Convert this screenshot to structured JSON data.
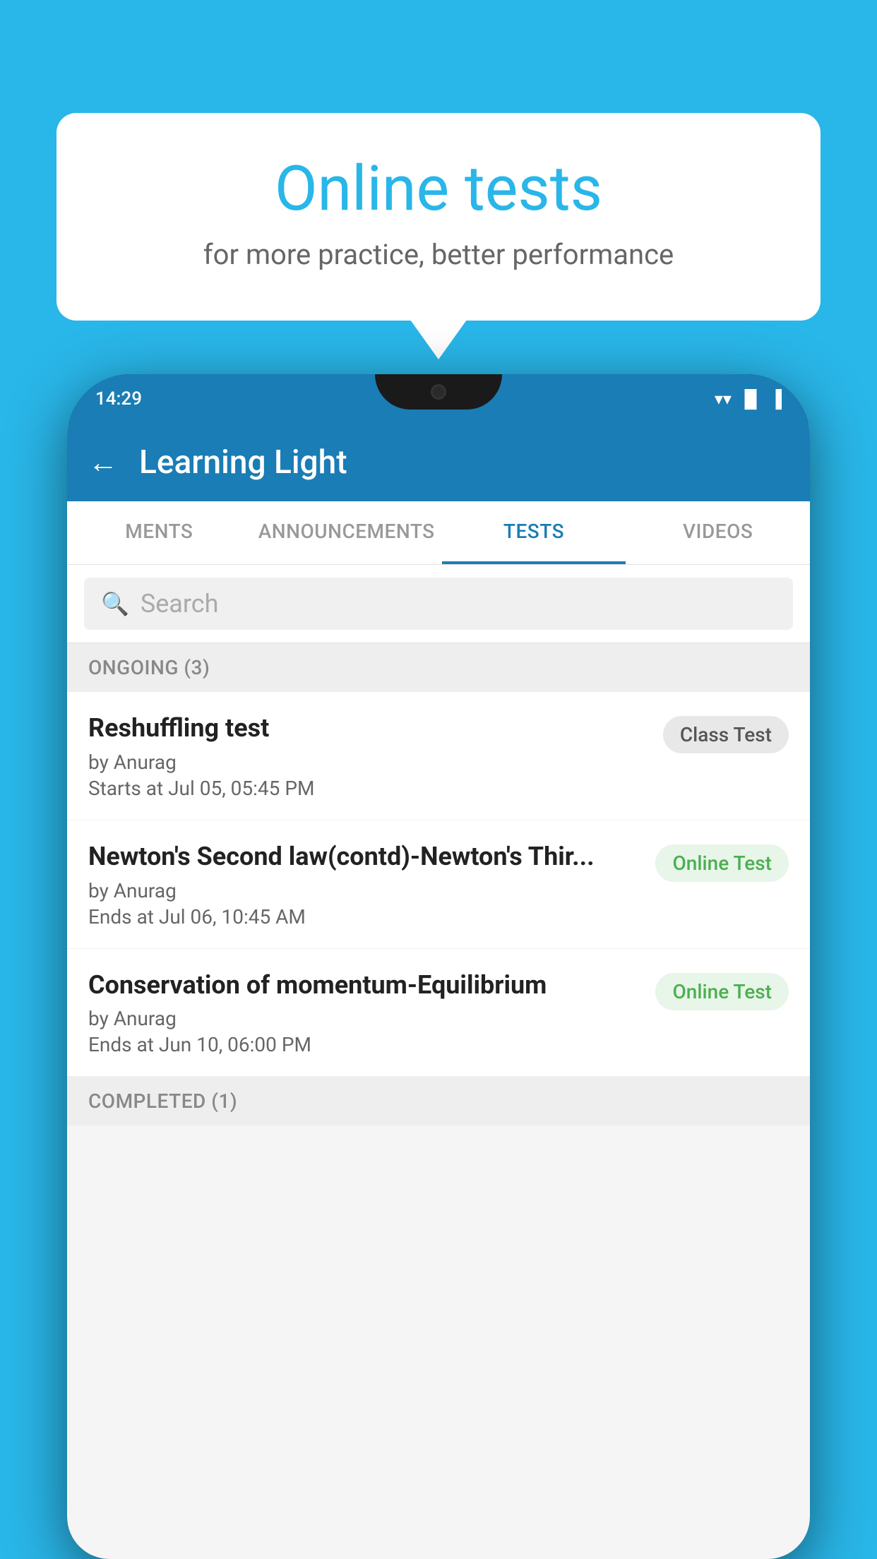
{
  "background_color": "#29B6E8",
  "speech_bubble": {
    "title": "Online tests",
    "subtitle": "for more practice, better performance"
  },
  "phone": {
    "status_bar": {
      "time": "14:29",
      "wifi": "▼",
      "signal": "▲",
      "battery": "▐"
    },
    "app_bar": {
      "title": "Learning Light",
      "back_label": "←"
    },
    "tabs": [
      {
        "label": "MENTS",
        "active": false
      },
      {
        "label": "ANNOUNCEMENTS",
        "active": false
      },
      {
        "label": "TESTS",
        "active": true
      },
      {
        "label": "VIDEOS",
        "active": false
      }
    ],
    "search": {
      "placeholder": "Search"
    },
    "ongoing_section": {
      "header": "ONGOING (3)",
      "items": [
        {
          "name": "Reshuffling test",
          "by": "by Anurag",
          "time_label": "Starts at",
          "time": "Jul 05, 05:45 PM",
          "badge": "Class Test",
          "badge_type": "class"
        },
        {
          "name": "Newton's Second law(contd)-Newton's Thir...",
          "by": "by Anurag",
          "time_label": "Ends at",
          "time": "Jul 06, 10:45 AM",
          "badge": "Online Test",
          "badge_type": "online"
        },
        {
          "name": "Conservation of momentum-Equilibrium",
          "by": "by Anurag",
          "time_label": "Ends at",
          "time": "Jun 10, 06:00 PM",
          "badge": "Online Test",
          "badge_type": "online"
        }
      ]
    },
    "completed_section": {
      "header": "COMPLETED (1)"
    }
  }
}
